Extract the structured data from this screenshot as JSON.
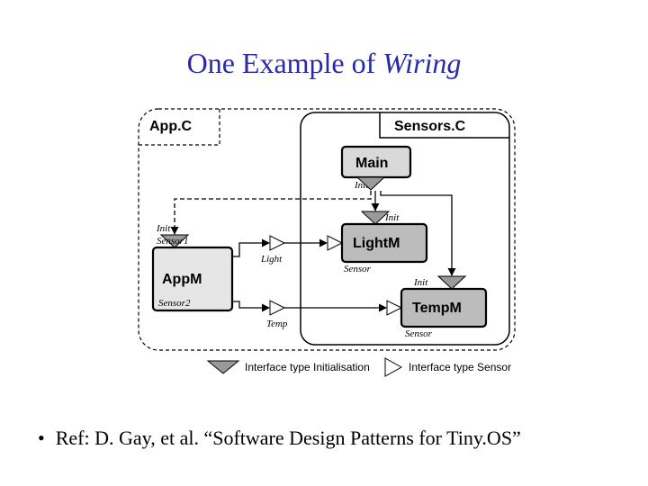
{
  "title_prefix": "One Example of ",
  "title_italic": "Wiring",
  "diagram": {
    "outer": "App.C",
    "inner_container": "Sensors.C",
    "components": {
      "main": "Main",
      "appm": "AppM",
      "lightm": "LightM",
      "tempm": "TempM"
    },
    "interfaces": {
      "init": "Init",
      "sensor1": "Sensor1",
      "sensor2": "Sensor2",
      "light": "Light",
      "temp": "Temp",
      "sensor": "Sensor"
    },
    "legend": {
      "init": "Interface type Initialisation",
      "sensor": "Interface type Sensor"
    }
  },
  "reference": "Ref: D. Gay, et al. “Software Design Patterns for Tiny.OS”"
}
